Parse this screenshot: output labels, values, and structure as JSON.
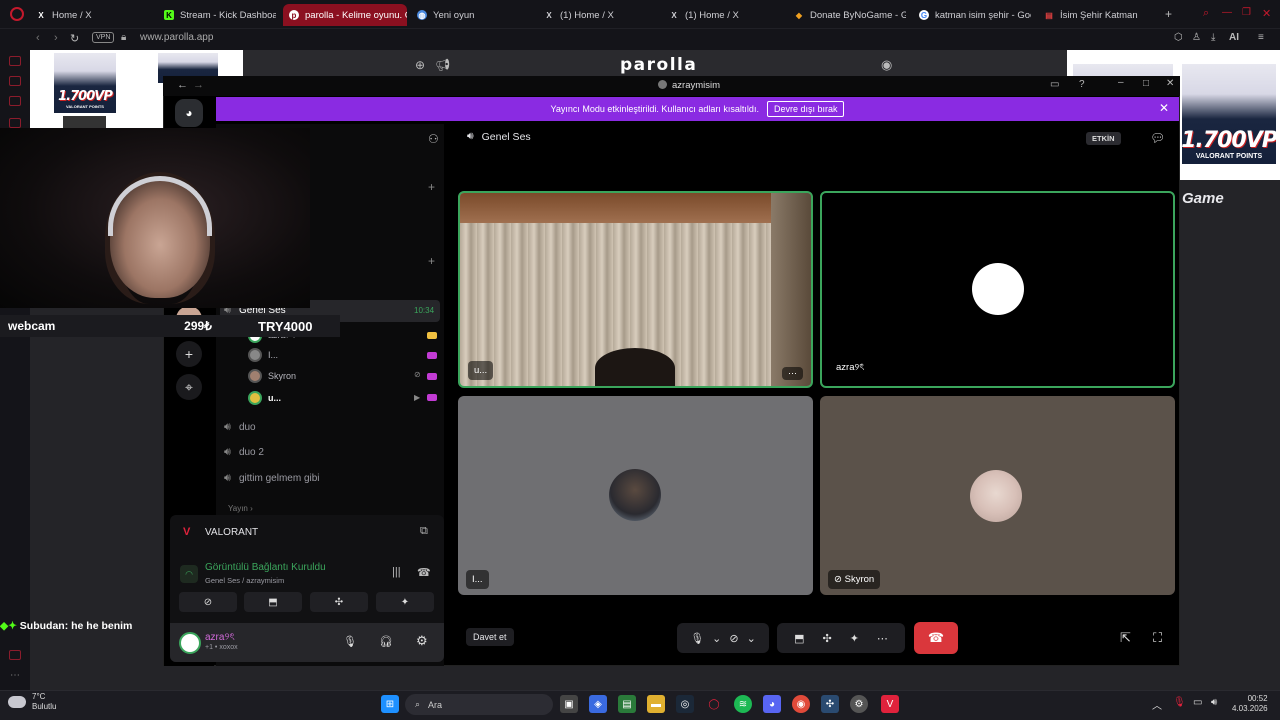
{
  "browser": {
    "tabs": [
      {
        "title": "Home / X",
        "icon": "x-icon",
        "fav": "X"
      },
      {
        "title": "Stream - Kick Dashboard",
        "icon": "kick-icon",
        "fav": "K"
      },
      {
        "title": "parolla - Kelime oyunu. Gü",
        "icon": "parolla-icon",
        "fav": "p",
        "active": true
      },
      {
        "title": "Yeni oyun",
        "icon": "globe-icon",
        "fav": "◍"
      },
      {
        "title": "(1) Home / X",
        "icon": "x-icon",
        "fav": "X"
      },
      {
        "title": "(1) Home / X",
        "icon": "x-icon",
        "fav": "X"
      },
      {
        "title": "Donate ByNoGame - Geli",
        "icon": "bynogame-icon",
        "fav": "◆"
      },
      {
        "title": "katman isim şehir - Googl",
        "icon": "google-icon",
        "fav": "G"
      },
      {
        "title": "İsim Şehir Katman",
        "icon": "site-icon",
        "fav": "▤"
      }
    ],
    "vpn_label": "VPN",
    "url": "www.parolla.app",
    "ai_label": "AI"
  },
  "page": {
    "site_title": "parolla",
    "ad_number": "1.700VP",
    "ad_points": "VALORANT POINTS",
    "sponsor_text": "Game"
  },
  "overlay": {
    "webcam_label": "webcam",
    "price_1": "299₺",
    "price_2": "TRY4000",
    "chat_user": "Subudan",
    "chat_message": ": he he benim"
  },
  "discord": {
    "window_title": "azraymisim",
    "banner_text": "Yayıncı Modu etkinleştirildi. Kullanıcı adları kısaltıldı.",
    "banner_button": "Devre dışı bırak",
    "active_channel": "Genel Ses",
    "active_channel_time": "10:34",
    "members": [
      {
        "name": "azra୨ৎ"
      },
      {
        "name": "I..."
      },
      {
        "name": "Skyron"
      },
      {
        "name": "u..."
      }
    ],
    "channels": [
      "duo",
      "duo 2",
      "gittim gelmem gibi"
    ],
    "category": "Yayın",
    "panel_game": "VALORANT",
    "panel_status": "Görüntülü Bağlantı Kuruldu",
    "panel_sub": "Genel Ses / azraymisim",
    "user_name": "azra୨ৎ",
    "user_sub": "+1 • xoxox",
    "call_title": "Genel Ses",
    "etkin_label": "ETKİN",
    "tiles": [
      {
        "name": "u..."
      },
      {
        "name": "azra୨ৎ"
      },
      {
        "name": "I..."
      },
      {
        "name": "Skyron"
      }
    ],
    "invite_label": "Davet et"
  },
  "taskbar": {
    "temp": "7°C",
    "weather": "Bulutlu",
    "search": "Ara",
    "time": "00:52",
    "date": "4.03.2026"
  },
  "colors": {
    "brand_red": "#8b1020",
    "discord_banner": "#8a2be2",
    "speaking_green": "#3ba55c",
    "hangup_red": "#da373c"
  }
}
